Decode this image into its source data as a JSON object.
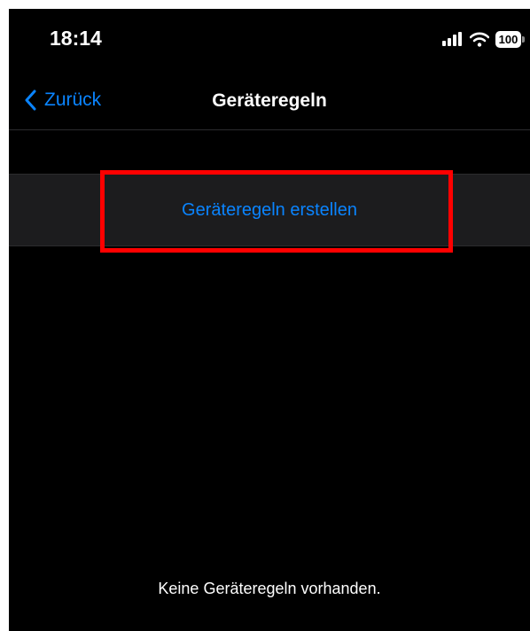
{
  "status_bar": {
    "time": "18:14",
    "battery": "100",
    "icons": [
      "signal-icon",
      "wifi-icon",
      "battery-icon"
    ]
  },
  "nav": {
    "back_label": "Zurück",
    "title": "Geräteregeln"
  },
  "main": {
    "create_button_label": "Geräteregeln erstellen",
    "empty_state": "Keine Geräteregeln vorhanden."
  },
  "colors": {
    "background": "#000000",
    "accent": "#0a84ff",
    "row_background": "#1c1c1e",
    "highlight": "#ff0000"
  }
}
